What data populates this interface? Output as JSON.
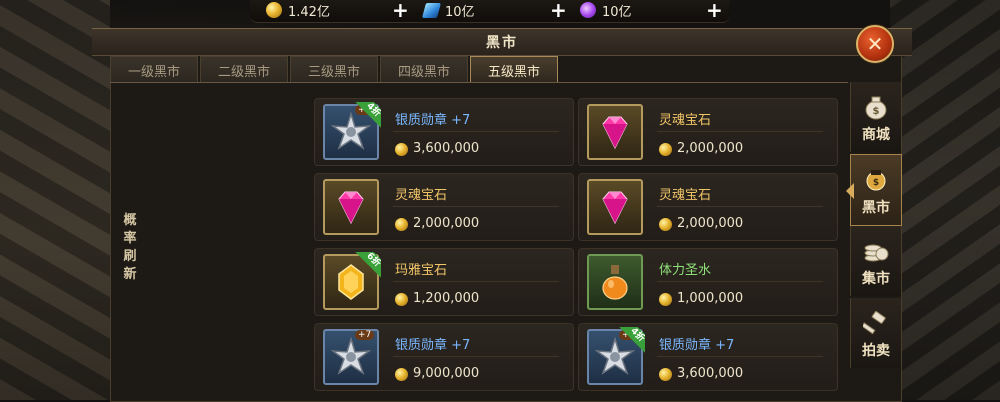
{
  "resources": {
    "gold": "1.42亿",
    "diamond": "10亿",
    "crystal": "10亿"
  },
  "window": {
    "title": "黑市"
  },
  "tabs": [
    {
      "label": "一级黑市",
      "active": false
    },
    {
      "label": "二级黑市",
      "active": false
    },
    {
      "label": "三级黑市",
      "active": false
    },
    {
      "label": "四级黑市",
      "active": false
    },
    {
      "label": "五级黑市",
      "active": true
    }
  ],
  "refresh_label": "概率刷新",
  "items": [
    {
      "name": "银质勋章 +7",
      "price": "3,600,000",
      "icon": "silver-medal-icon",
      "rarity": "blue",
      "badge": "4折",
      "enhance": "+7"
    },
    {
      "name": "灵魂宝石",
      "price": "2,000,000",
      "icon": "soul-gem-icon",
      "rarity": "gold",
      "badge": "",
      "enhance": ""
    },
    {
      "name": "灵魂宝石",
      "price": "2,000,000",
      "icon": "soul-gem-icon",
      "rarity": "gold",
      "badge": "",
      "enhance": ""
    },
    {
      "name": "灵魂宝石",
      "price": "2,000,000",
      "icon": "soul-gem-icon",
      "rarity": "gold",
      "badge": "",
      "enhance": ""
    },
    {
      "name": "玛雅宝石",
      "price": "1,200,000",
      "icon": "maya-gem-icon",
      "rarity": "gold",
      "badge": "6折",
      "enhance": ""
    },
    {
      "name": "体力圣水",
      "price": "1,000,000",
      "icon": "stamina-potion-icon",
      "rarity": "green",
      "badge": "",
      "enhance": ""
    },
    {
      "name": "银质勋章 +7",
      "price": "9,000,000",
      "icon": "silver-medal-icon",
      "rarity": "blue",
      "badge": "",
      "enhance": "+7"
    },
    {
      "name": "银质勋章 +7",
      "price": "3,600,000",
      "icon": "silver-medal-icon",
      "rarity": "blue",
      "badge": "4折",
      "enhance": "+7"
    }
  ],
  "side_nav": [
    {
      "label": "商城",
      "icon": "money-bag-icon",
      "active": false
    },
    {
      "label": "黑市",
      "icon": "black-market-icon",
      "active": true
    },
    {
      "label": "集市",
      "icon": "coin-stack-icon",
      "active": false
    },
    {
      "label": "拍卖",
      "icon": "gavel-icon",
      "active": false
    }
  ],
  "colors": {
    "rarity_blue": "#7ab8ff",
    "rarity_gold": "#f2c568",
    "rarity_green": "#8fe07a",
    "badge": "#3aa13a"
  }
}
